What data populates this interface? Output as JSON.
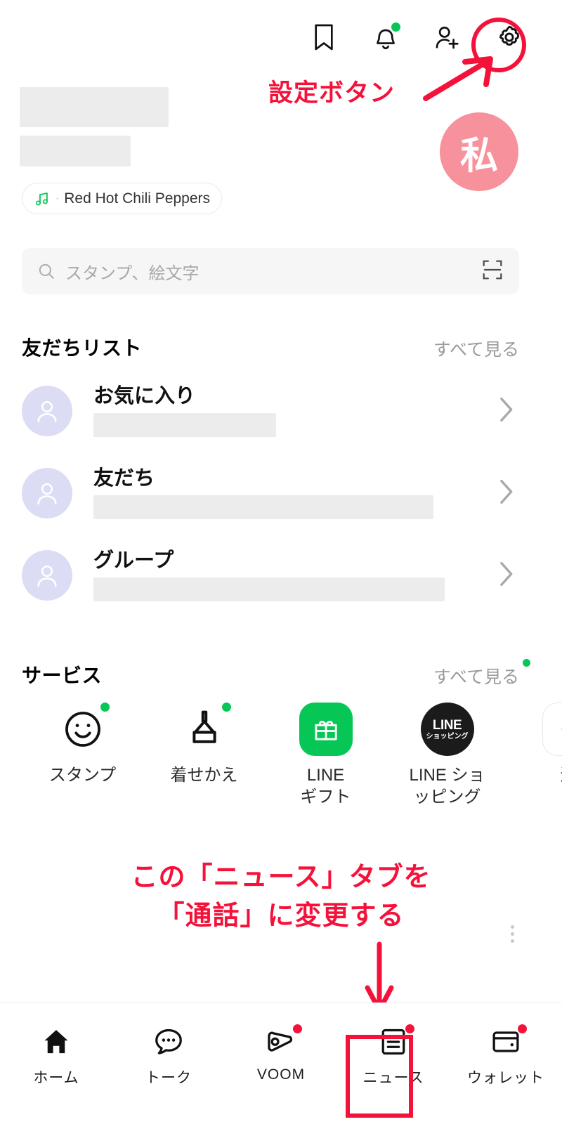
{
  "app": {
    "name": "LINE",
    "screen": "home"
  },
  "topbar": {
    "icons": [
      {
        "name": "bookmark-icon",
        "label": "キープ",
        "badge": false
      },
      {
        "name": "bell-icon",
        "label": "お知らせ",
        "badge": true,
        "badge_color": "#06C755"
      },
      {
        "name": "add-friend-icon",
        "label": "友だち追加",
        "badge": false
      },
      {
        "name": "gear-icon",
        "label": "設定",
        "badge": false,
        "highlighted": true
      }
    ]
  },
  "annotations": {
    "settings": {
      "text": "設定ボタン",
      "color": "#f5123a"
    },
    "news_tab_line1": "この「ニュース」タブを",
    "news_tab_line2": "「通話」に変更する",
    "highlight_color": "#f5123a"
  },
  "profile": {
    "name_redacted": true,
    "status_redacted": true,
    "avatar_text": "私",
    "avatar_color": "#f7919b",
    "music": {
      "icon": "music-note-icon",
      "separator": "·",
      "text": "Red Hot Chili Peppers"
    }
  },
  "search": {
    "icon": "search-icon",
    "placeholder": "スタンプ、絵文字",
    "scan_icon": "qr-scan-icon"
  },
  "friends_section": {
    "title": "友だちリスト",
    "see_all": "すべて見る",
    "see_all_badge": false,
    "rows": [
      {
        "title": "お気に入り",
        "sub_redacted_width": 260,
        "avatar": "person-avatar",
        "chevron": "chevron-right-icon"
      },
      {
        "title": "友だち",
        "sub_redacted_width": 484,
        "avatar": "person-avatar",
        "chevron": "chevron-right-icon"
      },
      {
        "title": "グループ",
        "sub_redacted_width": 500,
        "avatar": "person-avatar",
        "chevron": "chevron-right-icon"
      }
    ]
  },
  "services_section": {
    "title": "サービス",
    "see_all": "すべて見る",
    "see_all_badge": true,
    "items": [
      {
        "label": "スタンプ",
        "icon": "smiley-face-icon",
        "badge": true,
        "style": "outline"
      },
      {
        "label": "着せかえ",
        "icon": "brush-icon",
        "badge": true,
        "style": "outline"
      },
      {
        "label": "LINE\nギフト",
        "label_line1": "LINE",
        "label_line2": "ギフト",
        "icon": "gift-icon",
        "badge": false,
        "style": "green-tile"
      },
      {
        "label_line1": "LINE ショ",
        "label_line2": "ッピング",
        "icon": "line-shopping-icon",
        "tile_text_1": "LINE",
        "tile_text_2": "ショッピング",
        "badge": false,
        "style": "black-tile"
      },
      {
        "label_line1": "追",
        "icon": "plus-icon",
        "badge": false,
        "style": "plus-tile"
      }
    ]
  },
  "bottom_nav": {
    "items": [
      {
        "label": "ホーム",
        "icon": "home-icon",
        "active": true,
        "badge": false
      },
      {
        "label": "トーク",
        "icon": "chat-bubble-icon",
        "active": false,
        "badge": false
      },
      {
        "label": "VOOM",
        "icon": "voom-play-icon",
        "active": false,
        "badge": true
      },
      {
        "label": "ニュース",
        "icon": "news-document-icon",
        "active": false,
        "badge": true,
        "highlighted": true
      },
      {
        "label": "ウォレット",
        "icon": "wallet-icon",
        "active": false,
        "badge": true
      }
    ]
  }
}
